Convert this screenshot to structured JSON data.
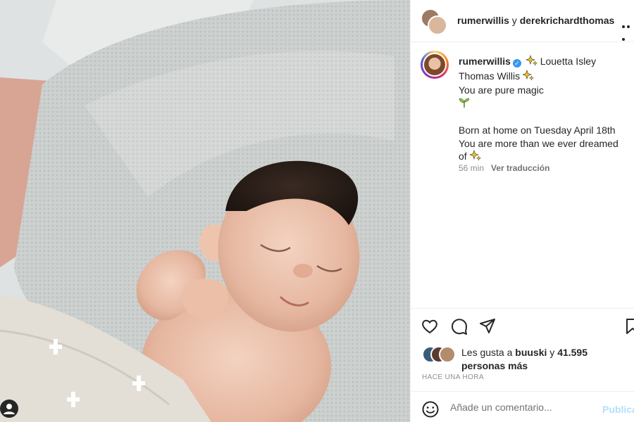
{
  "post": {
    "image": {
      "alt": "",
      "subject": "sleeping newborn baby on a knit blanket"
    },
    "tag_icon": "person-tag-icon"
  },
  "header": {
    "user1": "rumerwillis",
    "connector": " y ",
    "user2": "derekrichardthomas",
    "more_icon": "more-horizontal-icon"
  },
  "caption": {
    "username": "rumerwillis",
    "verified_icon": "verified-badge-icon",
    "line1": "Louetta Isley",
    "line2": "Thomas Willis",
    "line3": "You are pure magic",
    "line4": "Born at home on Tuesday April 18th",
    "line5": "You are more than we ever dreamed",
    "line6": "of",
    "emoji_sparkle": "sparkles-emoji",
    "emoji_seedling": "seedling-emoji"
  },
  "meta": {
    "time": "56 min",
    "translate": "Ver traducción"
  },
  "actions": {
    "like_icon": "heart-icon",
    "comment_icon": "comment-icon",
    "share_icon": "paper-plane-icon",
    "save_icon": "bookmark-icon"
  },
  "likes": {
    "prefix": "Les gusta a ",
    "user": "buuski",
    "mid": " y ",
    "count": "41.595 personas más"
  },
  "timeago": "HACE UNA HORA",
  "comment": {
    "placeholder": "Añade un comentario...",
    "publish": "Publicar",
    "emoji_icon": "smile-icon"
  },
  "colors": {
    "text": "#262626",
    "muted": "#8e8e8e",
    "publish_disabled": "#b2dffc",
    "verified": "#3897f0"
  }
}
